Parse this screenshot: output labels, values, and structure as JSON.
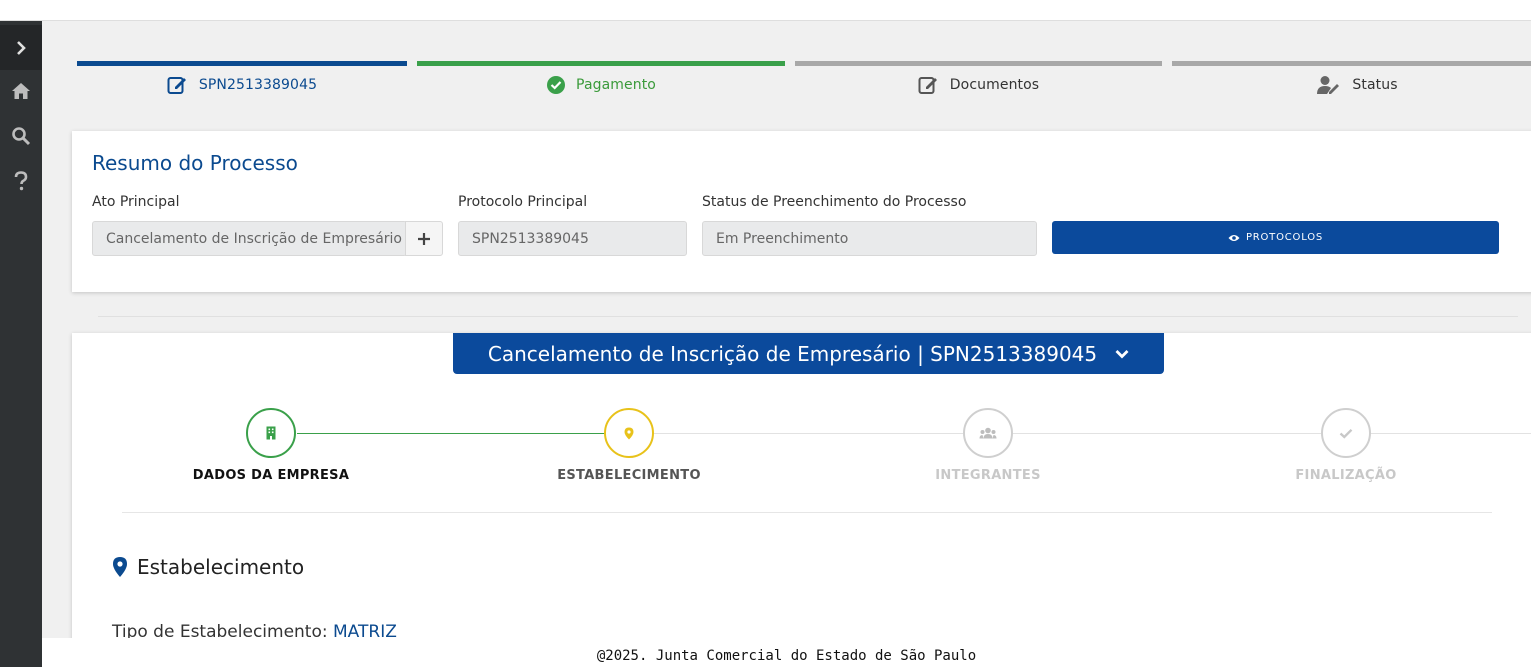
{
  "wizard": {
    "steps": [
      {
        "label": "SPN2513389045",
        "icon": "edit-icon",
        "color": "#0b4a8f",
        "bar_color": "#0b4a8f"
      },
      {
        "label": "Pagamento",
        "icon": "check-circle-icon",
        "color": "#3a9a3a",
        "bar_color": "#3aa04a"
      },
      {
        "label": "Documentos",
        "icon": "edit-icon",
        "color": "#333333",
        "bar_color": "#a8a8a8"
      },
      {
        "label": "Status",
        "icon": "user-edit-icon",
        "color": "#333333",
        "bar_color": "#a8a8a8"
      }
    ]
  },
  "resumo": {
    "title": "Resumo do Processo",
    "ato_label": "Ato Principal",
    "ato_value": "Cancelamento de Inscrição de Empresário",
    "protocolo_label": "Protocolo Principal",
    "protocolo_value": "SPN2513389045",
    "status_label": "Status de Preenchimento do Processo",
    "status_value": "Em Preenchimento",
    "protocolos_button": "PROTOCOLOS"
  },
  "processo": {
    "header": "Cancelamento de Inscrição de Empresário | SPN2513389045",
    "stages": [
      {
        "label": "DADOS DA EMPRESA",
        "icon": "building-icon",
        "state": "done"
      },
      {
        "label": "ESTABELECIMENTO",
        "icon": "map-pin-icon",
        "state": "current"
      },
      {
        "label": "INTEGRANTES",
        "icon": "users-icon",
        "state": "pending"
      },
      {
        "label": "FINALIZAÇÃO",
        "icon": "check-icon",
        "state": "pending"
      }
    ],
    "section_title": "Estabelecimento",
    "tipo_label": "Tipo de Estabelecimento:",
    "tipo_value": "MATRIZ"
  },
  "footer": {
    "text": "@2025. Junta Comercial do Estado de São Paulo"
  },
  "colors": {
    "primary": "#0b4a9c",
    "success": "#3aa04a",
    "warning": "#e8c21a",
    "muted": "#c8c8c8"
  }
}
